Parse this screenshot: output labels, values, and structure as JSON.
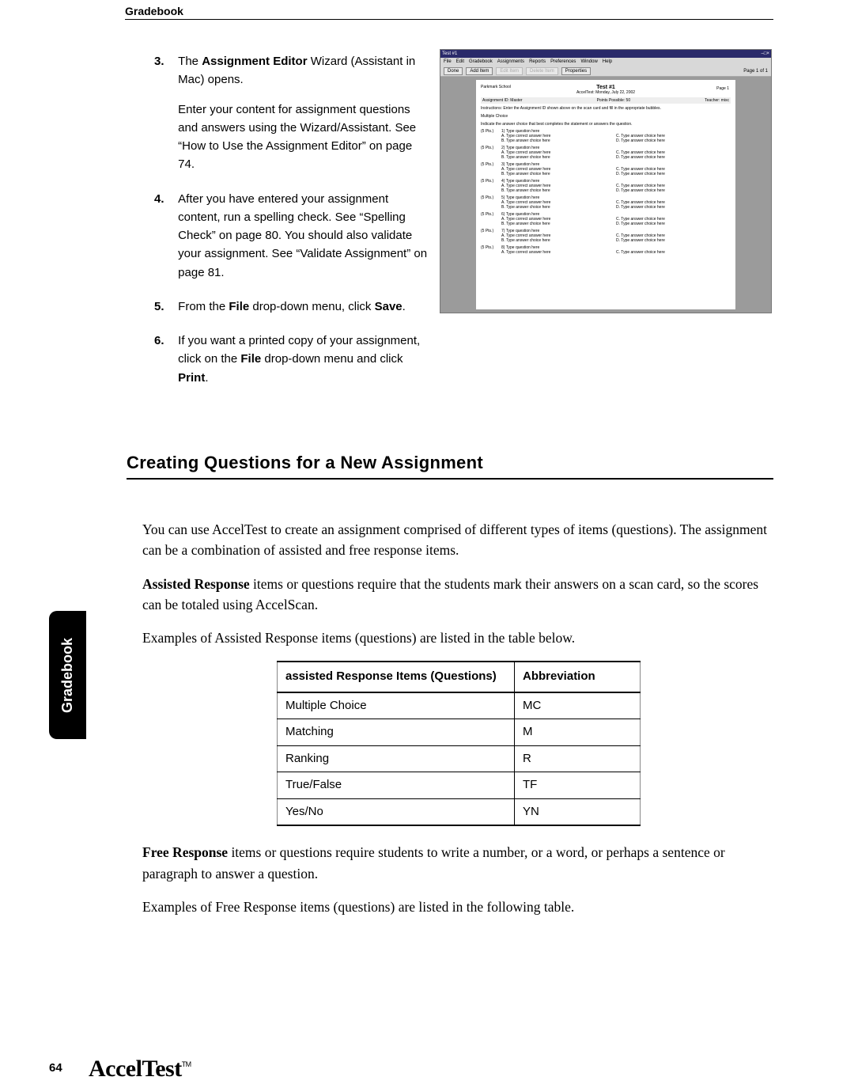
{
  "header": {
    "title": "Gradebook"
  },
  "steps": [
    {
      "num": "3.",
      "segments": [
        {
          "t": "The "
        },
        {
          "t": "Assignment Editor",
          "b": true
        },
        {
          "t": " Wizard (Assistant in Mac) opens."
        }
      ],
      "sub": "Enter your content for assignment questions and answers using the Wizard/Assistant. See “How to Use the Assignment Editor” on page 74."
    },
    {
      "num": "4.",
      "segments": [
        {
          "t": "After you have entered your assignment content, run a spelling check. See “Spelling Check” on page 80. You should also validate your assignment. See “Validate Assignment” on page 81."
        }
      ]
    },
    {
      "num": "5.",
      "segments": [
        {
          "t": " From the "
        },
        {
          "t": "File",
          "b": true
        },
        {
          "t": " drop-down menu, click "
        },
        {
          "t": "Save",
          "b": true
        },
        {
          "t": "."
        }
      ]
    },
    {
      "num": "6.",
      "segments": [
        {
          "t": "If you want a printed copy of your assignment, click on the "
        },
        {
          "t": "File",
          "b": true
        },
        {
          "t": " drop-down menu and click "
        },
        {
          "t": "Print",
          "b": true
        },
        {
          "t": "."
        }
      ]
    }
  ],
  "screenshot": {
    "win_title": "Test #1",
    "win_controls": "–□×",
    "menus": [
      "File",
      "Edit",
      "Gradebook",
      "Assignments",
      "Reports",
      "Preferences",
      "Window",
      "Help"
    ],
    "buttons": [
      {
        "label": "Done",
        "enabled": true
      },
      {
        "label": "Add Item",
        "enabled": true
      },
      {
        "label": "Edit Item",
        "enabled": false
      },
      {
        "label": "Delete Item",
        "enabled": false
      },
      {
        "label": "Properties",
        "enabled": true
      }
    ],
    "page_indicator": "Page 1 of 1",
    "doc": {
      "school": "Parkmark School",
      "title": "Test #1",
      "subtitle": "AccelTest: Monday, July 22, 2002",
      "page": "Page 1",
      "assignment_id": "Assignment ID: Master",
      "points": "Points Possible: 50",
      "teacher": "Teacher: misc",
      "instructions": "Instructions: Enter the Assignment ID shown above on the scan card and fill in the appropriate bubbles.",
      "section_label": "Multiple Choice",
      "q_instructions": "Indicate the answer choice that best completes the statement or answers the question.",
      "pts_label": "(5 Pts.)",
      "q_text": "Type question here",
      "options": [
        "A. Type correct answer here",
        "B. Type answer choice here",
        "C. Type answer choice here",
        "D. Type answer choice here"
      ],
      "question_numbers": [
        "1)",
        "2)",
        "3)",
        "4)",
        "5)",
        "6)",
        "7)",
        "8)"
      ]
    }
  },
  "section": {
    "heading": "Creating Questions for a New Assignment",
    "intro": "You can use AccelTest to create an assignment comprised of different types of items (questions). The assignment can be a combination of assisted and free response items.",
    "assisted_label": "Assisted Response",
    "assisted_text": " items or questions require that the students mark their answers on a scan card, so the scores can be totaled using AccelScan.",
    "examples_assisted": "Examples of Assisted Response items (questions) are listed in the table below.",
    "table": {
      "headers": [
        "assisted Response Items (Questions)",
        "Abbreviation"
      ],
      "rows": [
        [
          "Multiple Choice",
          "MC"
        ],
        [
          "Matching",
          "M"
        ],
        [
          "Ranking",
          "R"
        ],
        [
          "True/False",
          "TF"
        ],
        [
          "Yes/No",
          "YN"
        ]
      ]
    },
    "free_label": "Free Response",
    "free_text": " items or questions require students to write a number, or a word, or perhaps a sentence or paragraph to answer a question.",
    "examples_free": "Examples of Free Response items (questions) are listed in the following table."
  },
  "side_tab": "Gradebook",
  "page_number": "64",
  "footer_logo": "AccelTest",
  "footer_tm": "TM"
}
